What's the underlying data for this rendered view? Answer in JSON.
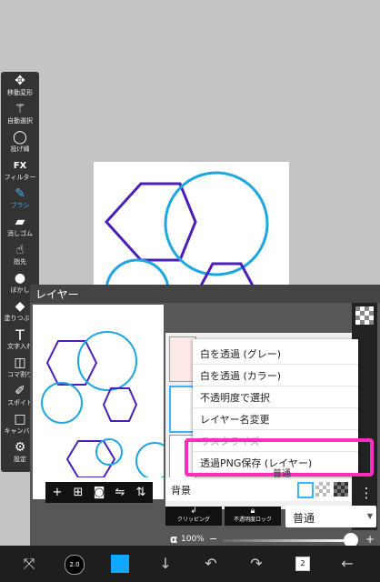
{
  "toolbar": {
    "items": [
      {
        "label": "移動変形",
        "icon": "move-icon",
        "glyph": "✥"
      },
      {
        "label": "自動選択",
        "icon": "magic-wand-icon",
        "glyph": "⚚"
      },
      {
        "label": "投げ縄",
        "icon": "lasso-icon",
        "glyph": "◯"
      },
      {
        "label": "フィルター",
        "icon": "fx-icon",
        "glyph": "FX"
      },
      {
        "label": "ブラシ",
        "icon": "brush-icon",
        "glyph": "✎"
      },
      {
        "label": "消しゴム",
        "icon": "eraser-icon",
        "glyph": "▰"
      },
      {
        "label": "指先",
        "icon": "finger-icon",
        "glyph": "☝"
      },
      {
        "label": "ぼかし",
        "icon": "blur-icon",
        "glyph": "●"
      },
      {
        "label": "塗りつぶし",
        "icon": "fill-icon",
        "glyph": "◆"
      },
      {
        "label": "文字入れ",
        "icon": "text-icon",
        "glyph": "T"
      },
      {
        "label": "コマ割り",
        "icon": "frame-icon",
        "glyph": "◫"
      },
      {
        "label": "スポイト",
        "icon": "eyedropper-icon",
        "glyph": "✐"
      },
      {
        "label": "キャンバス",
        "icon": "canvas-icon",
        "glyph": "□"
      },
      {
        "label": "設定",
        "icon": "settings-icon",
        "glyph": "⚙"
      }
    ],
    "active_index": 4
  },
  "layer_panel": {
    "title": "レイヤー",
    "background_label": "背景",
    "clipping_label": "クリッピング",
    "lock_label": "不透明度ロック",
    "blend_mode": "普通",
    "opacity": "100%",
    "opacity_value": 1.0,
    "alpha_symbol": "α",
    "layer_row_partial": "普通"
  },
  "context_menu": {
    "items": [
      {
        "label": "白を透過 (グレー)",
        "enabled": true
      },
      {
        "label": "白を透過 (カラー)",
        "enabled": true
      },
      {
        "label": "不透明度で選択",
        "enabled": true
      },
      {
        "label": "レイヤー名変更",
        "enabled": true
      },
      {
        "label": "ラスタライズ",
        "enabled": false
      },
      {
        "label": "透過PNG保存 (レイヤー)",
        "enabled": true
      }
    ]
  },
  "bottom_bar": {
    "layer_count": "2",
    "brush_size": "2.0"
  },
  "colors": {
    "accent": "#3db2ff",
    "current_color": "#10a8ff",
    "highlight": "#ff2dbd",
    "hexagon_stroke": "#4b1fb8",
    "circle_stroke": "#1ea6e0"
  }
}
